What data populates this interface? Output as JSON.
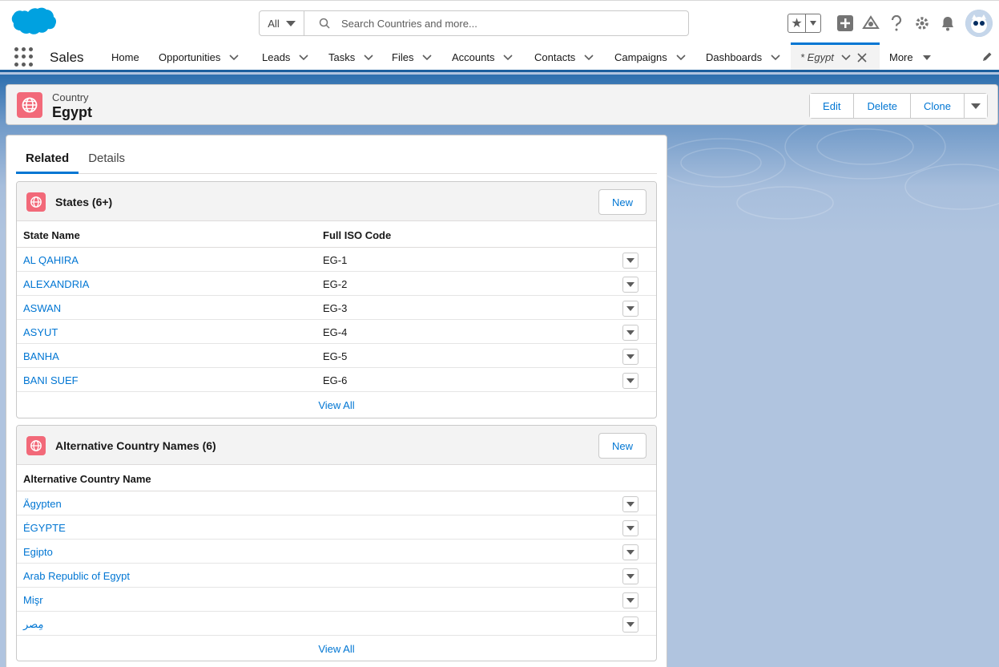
{
  "header": {
    "search_scope": "All",
    "search_placeholder": "Search Countries and more..."
  },
  "nav": {
    "app_name": "Sales",
    "items": [
      {
        "label": "Home",
        "has_menu": false
      },
      {
        "label": "Opportunities",
        "has_menu": true
      },
      {
        "label": "Leads",
        "has_menu": true
      },
      {
        "label": "Tasks",
        "has_menu": true
      },
      {
        "label": "Files",
        "has_menu": true
      },
      {
        "label": "Accounts",
        "has_menu": true
      },
      {
        "label": "Contacts",
        "has_menu": true
      },
      {
        "label": "Campaigns",
        "has_menu": true
      },
      {
        "label": "Dashboards",
        "has_menu": true
      }
    ],
    "active_tab": "* Egypt",
    "more_label": "More"
  },
  "record": {
    "type": "Country",
    "name": "Egypt",
    "actions": [
      "Edit",
      "Delete",
      "Clone"
    ]
  },
  "tabs": [
    "Related",
    "Details"
  ],
  "states": {
    "title": "States (6+)",
    "new_label": "New",
    "columns": [
      "State Name",
      "Full ISO Code"
    ],
    "rows": [
      {
        "name": "AL QAHIRA",
        "code": "EG-1"
      },
      {
        "name": "ALEXANDRIA",
        "code": "EG-2"
      },
      {
        "name": "ASWAN",
        "code": "EG-3"
      },
      {
        "name": "ASYUT",
        "code": "EG-4"
      },
      {
        "name": "BANHA",
        "code": "EG-5"
      },
      {
        "name": "BANI SUEF",
        "code": "EG-6"
      }
    ],
    "view_all": "View All"
  },
  "alt_names": {
    "title": "Alternative Country Names (6)",
    "new_label": "New",
    "columns": [
      "Alternative Country Name"
    ],
    "rows": [
      "Ägypten",
      "ÉGYPTE",
      "Egipto",
      "Arab Republic of Egypt",
      "Mişr",
      "مِصر"
    ],
    "view_all": "View All"
  },
  "colors": {
    "brand_blue": "#0176d3",
    "record_icon": "#f26979",
    "nav_border": "#1b5f9e"
  }
}
